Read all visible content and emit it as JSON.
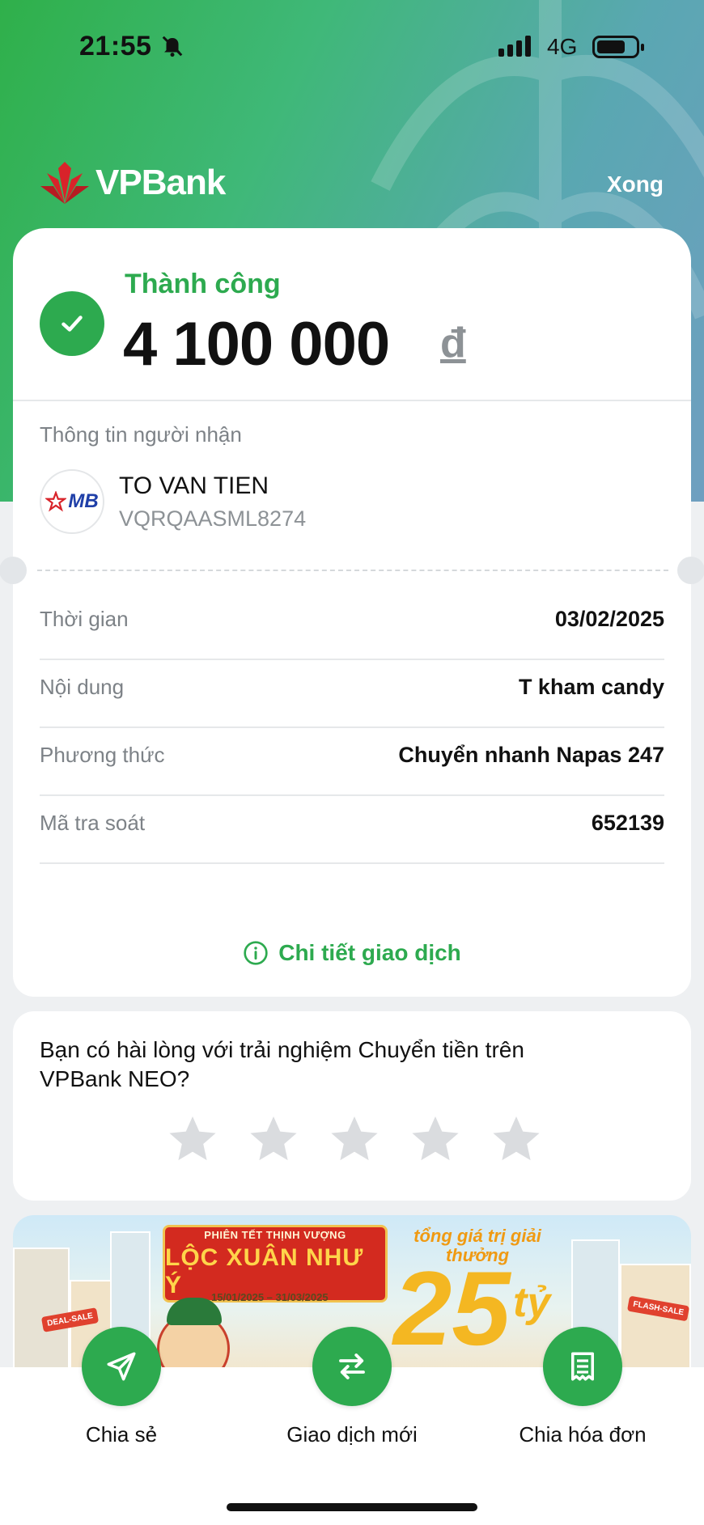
{
  "status_bar": {
    "time": "21:55",
    "network": "4G"
  },
  "header": {
    "brand": "VPBank",
    "done_label": "Xong"
  },
  "result": {
    "status": "Thành công",
    "amount": "4 100 000",
    "currency": "đ"
  },
  "recipient": {
    "section_title": "Thông tin người nhận",
    "bank_logo_text": "MB",
    "name": "TO VAN TIEN",
    "account": "VQRQAASML8274"
  },
  "details": [
    {
      "label": "Thời gian",
      "value": "03/02/2025"
    },
    {
      "label": "Nội dung",
      "value": "T kham candy"
    },
    {
      "label": "Phương thức",
      "value": "Chuyển nhanh Napas 247"
    },
    {
      "label": "Mã tra soát",
      "value": "652139"
    }
  ],
  "detail_link": "Chi tiết giao dịch",
  "rating": {
    "question": "Bạn có hài lòng với trải nghiệm Chuyển tiền trên VPBank NEO?",
    "stars": 5,
    "selected": 0
  },
  "banner": {
    "heading_small": "PHIÊN TẾT THỊNH VƯỢNG",
    "heading_big": "LỘC XUÂN NHƯ Ý",
    "dates": "15/01/2025 – 31/03/2025",
    "prize_label": "tổng giá trị giải thưởng",
    "prize_value": "25",
    "prize_unit": "tỷ",
    "sign_left": "DEAL-SALE",
    "sign_right": "FLASH-SALE"
  },
  "actions": [
    {
      "label": "Chia sẻ",
      "icon": "send-icon"
    },
    {
      "label": "Giao dịch mới",
      "icon": "swap-arrows-icon"
    },
    {
      "label": "Chia hóa đơn",
      "icon": "receipt-icon"
    }
  ],
  "colors": {
    "primary_green": "#2daa4f",
    "star_gray": "#dadcdf",
    "brand_red": "#d8232a"
  }
}
